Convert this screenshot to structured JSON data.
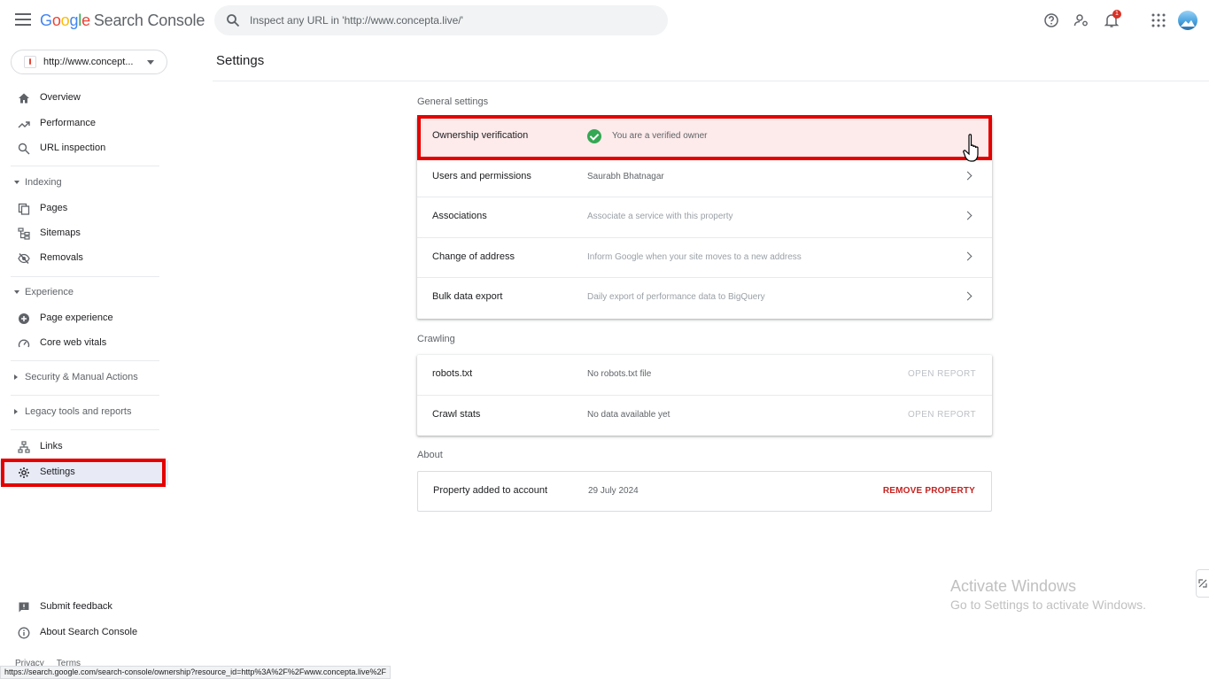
{
  "header": {
    "logo_google": [
      "G",
      "o",
      "o",
      "g",
      "l",
      "e"
    ],
    "logo_product": "Search Console",
    "search_placeholder": "Inspect any URL in 'http://www.concepta.live/'",
    "notification_count": "1",
    "icons": [
      "help-icon",
      "manage-users-icon",
      "notifications-icon",
      "apps-icon",
      "avatar"
    ]
  },
  "sidebar": {
    "property": "http://www.concept...",
    "items": [
      {
        "label": "Overview",
        "icon": "home-icon"
      },
      {
        "label": "Performance",
        "icon": "trending-up-icon"
      },
      {
        "label": "URL inspection",
        "icon": "search-icon"
      },
      {
        "label": "Pages",
        "icon": "pages-icon"
      },
      {
        "label": "Sitemaps",
        "icon": "sitemap-icon"
      },
      {
        "label": "Removals",
        "icon": "removals-icon"
      },
      {
        "label": "Page experience",
        "icon": "plus-circle-icon"
      },
      {
        "label": "Core web vitals",
        "icon": "speed-icon"
      },
      {
        "label": "Links",
        "icon": "links-icon"
      },
      {
        "label": "Settings",
        "icon": "gear-icon"
      },
      {
        "label": "Submit feedback",
        "icon": "feedback-icon"
      },
      {
        "label": "About Search Console",
        "icon": "info-icon"
      }
    ],
    "sections": {
      "indexing": "Indexing",
      "experience": "Experience",
      "security": "Security & Manual Actions",
      "legacy": "Legacy tools and reports"
    },
    "footer": {
      "privacy": "Privacy",
      "terms": "Terms"
    }
  },
  "main": {
    "title": "Settings",
    "general": {
      "title": "General settings",
      "rows": [
        {
          "label": "Ownership verification",
          "value": "You are a verified owner"
        },
        {
          "label": "Users and permissions",
          "value": "Saurabh Bhatnagar"
        },
        {
          "label": "Associations",
          "value": "Associate a service with this property"
        },
        {
          "label": "Change of address",
          "value": "Inform Google when your site moves to a new address"
        },
        {
          "label": "Bulk data export",
          "value": "Daily export of performance data to BigQuery"
        }
      ]
    },
    "crawling": {
      "title": "Crawling",
      "rows": [
        {
          "label": "robots.txt",
          "value": "No robots.txt file",
          "action": "OPEN REPORT"
        },
        {
          "label": "Crawl stats",
          "value": "No data available yet",
          "action": "OPEN REPORT"
        }
      ]
    },
    "about": {
      "title": "About",
      "label": "Property added to account",
      "value": "29 July 2024",
      "action": "REMOVE PROPERTY"
    }
  },
  "status_bar_url": "https://search.google.com/search-console/ownership?resource_id=http%3A%2F%2Fwww.concepta.live%2F",
  "watermark": {
    "line1": "Activate Windows",
    "line2": "Go to Settings to activate Windows."
  },
  "colors": {
    "highlight_box": "#e50000",
    "verified": "#34a853",
    "remove": "#c5221f",
    "active_nav": "#e8eaf6"
  }
}
